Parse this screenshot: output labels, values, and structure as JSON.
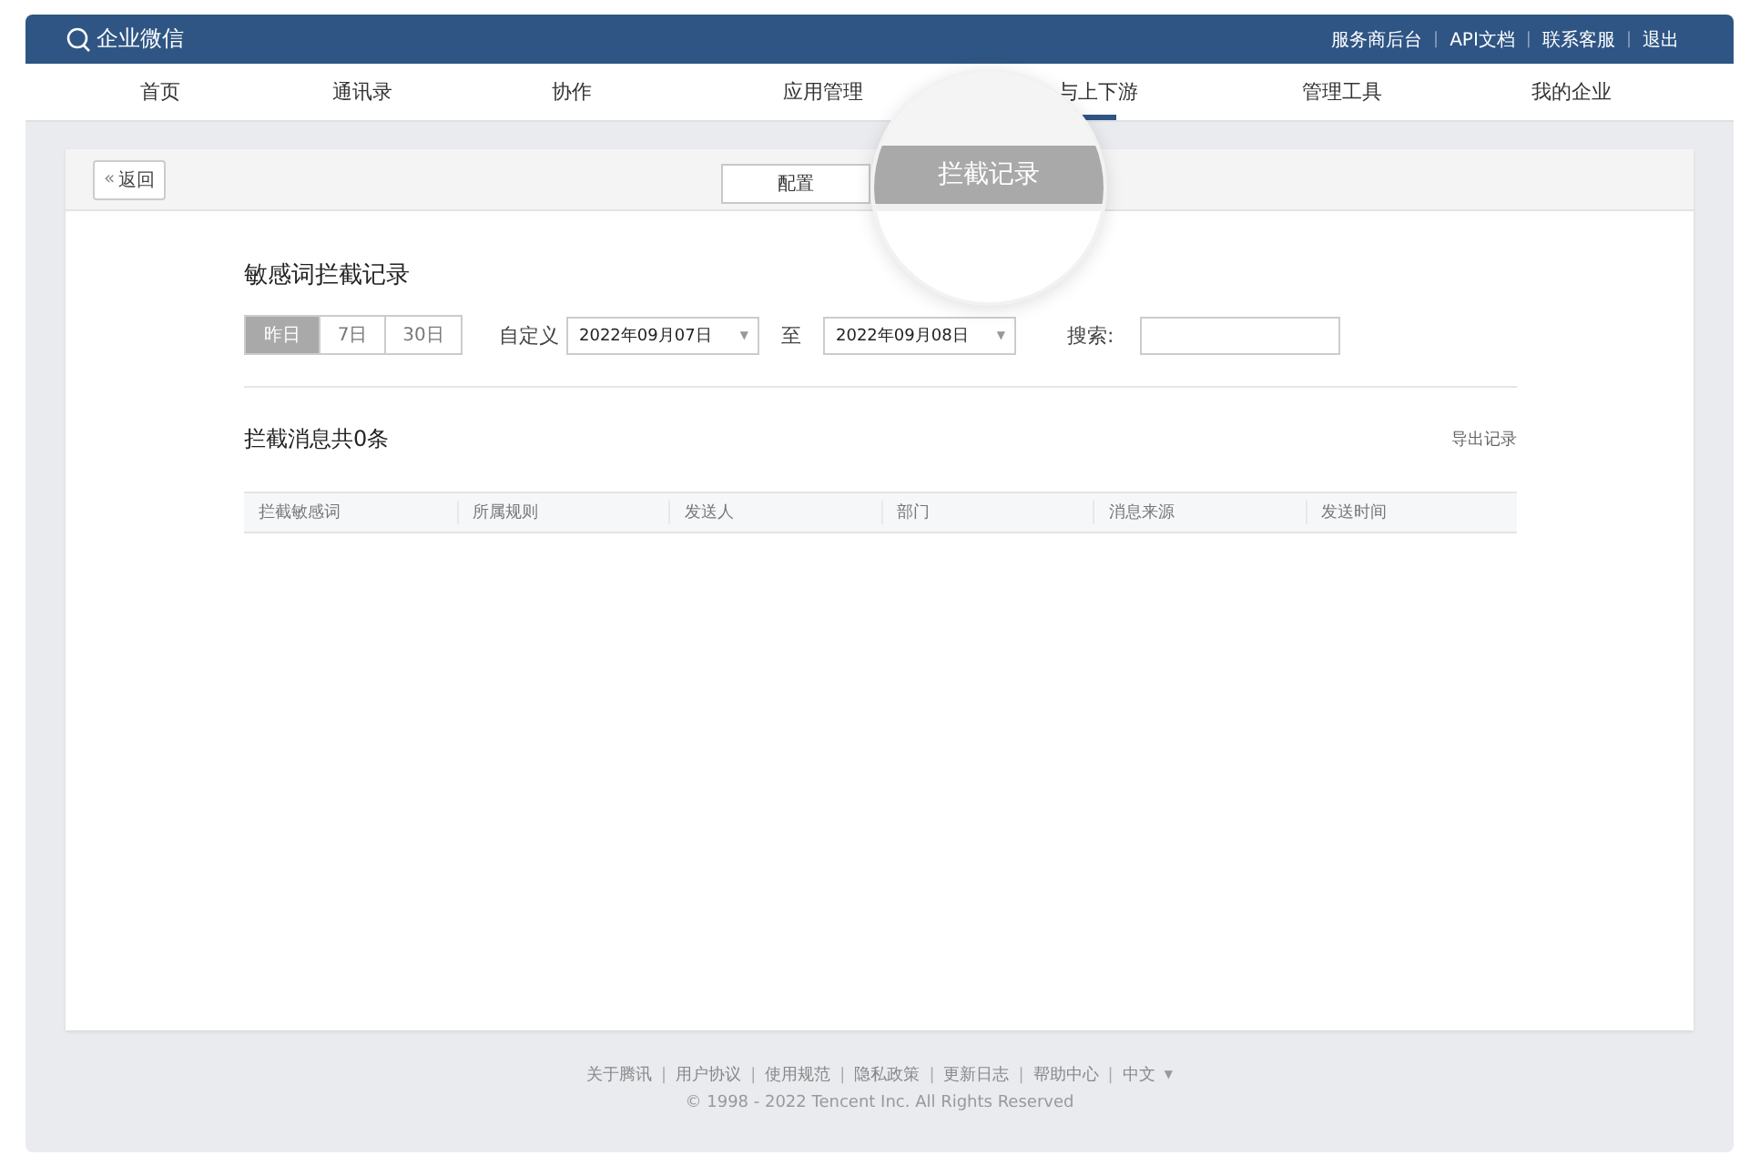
{
  "header": {
    "logo": "企业微信",
    "links": [
      "服务商后台",
      "API文档",
      "联系客服",
      "退出"
    ],
    "separator": "|"
  },
  "nav": [
    {
      "label": "首页",
      "selected": false
    },
    {
      "label": "通讯录",
      "selected": false
    },
    {
      "label": "协作",
      "selected": false
    },
    {
      "label": "应用管理",
      "selected": false
    },
    {
      "label": "与上下游",
      "selected": true
    },
    {
      "label": "管理工具",
      "selected": false
    },
    {
      "label": "我的企业",
      "selected": false
    }
  ],
  "back_button": {
    "icon": "«",
    "label": "返回"
  },
  "tabs": [
    {
      "label": "配置",
      "selected": false
    },
    {
      "label": "拦截记录",
      "selected": true
    }
  ],
  "section_title": "敏感词拦截记录",
  "ranges": [
    {
      "label": "昨日",
      "selected": true
    },
    {
      "label": "7日",
      "selected": false
    },
    {
      "label": "30日",
      "selected": false
    }
  ],
  "custom_label": "自定义",
  "date_from": {
    "value": "2022年09月07日",
    "caret": "▼"
  },
  "to_label": "至",
  "date_to": {
    "value": "2022年09月08日",
    "caret": "▼"
  },
  "search_label": "搜索:",
  "result_title": "拦截消息共0条",
  "export_link": "导出记录",
  "table": {
    "columns": [
      "拦截敏感词",
      "所属规则",
      "发送人",
      "部门",
      "消息来源",
      "发送时间"
    ]
  },
  "footer": {
    "links": [
      "关于腾讯",
      "用户协议",
      "使用规范",
      "隐私政策",
      "更新日志",
      "帮助中心"
    ],
    "separator": "|",
    "language": "中文",
    "language_caret": "▼",
    "copyright": "© 1998 - 2022 Tencent Inc. All Rights Reserved"
  }
}
